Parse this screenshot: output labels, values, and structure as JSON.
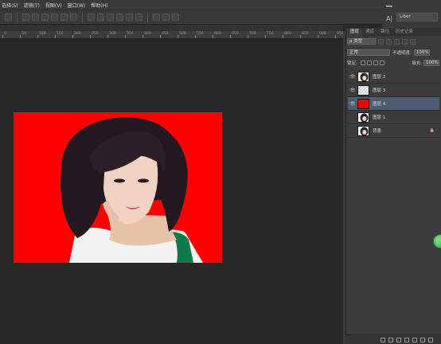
{
  "menu": [
    "选择(S)",
    "滤镜(T)",
    "视图(V)",
    "窗口(W)",
    "帮助(H)"
  ],
  "workspace": "Liber",
  "ruler": [
    "0",
    "50",
    "100",
    "150",
    "200",
    "250",
    "300",
    "350",
    "400",
    "450",
    "500",
    "550",
    "600",
    "650",
    "700",
    "750",
    "800",
    "850",
    "900",
    "950"
  ],
  "panel": {
    "tabs": [
      "图层",
      "通道",
      "路径",
      "历史记录"
    ],
    "filter_kind": "ρ 类型",
    "blend_mode": "正常",
    "opacity_label": "不透明度:",
    "opacity_value": "100%",
    "lock_label": "锁定:",
    "fill_label": "填充:",
    "fill_value": "100%"
  },
  "layers": [
    {
      "name": "图层 2",
      "visible": true,
      "thumb": "photo"
    },
    {
      "name": "图层 3",
      "visible": true,
      "thumb": "checker"
    },
    {
      "name": "图层 4",
      "visible": true,
      "thumb": "red",
      "selected": true
    },
    {
      "name": "图层 1",
      "visible": false,
      "thumb": "photo"
    },
    {
      "name": "背景",
      "visible": false,
      "thumb": "photo",
      "locked": true
    }
  ],
  "colors": {
    "canvas_fill": "#ff0000",
    "selected_layer": "#4f5d73",
    "ui_bg": "#282828"
  }
}
